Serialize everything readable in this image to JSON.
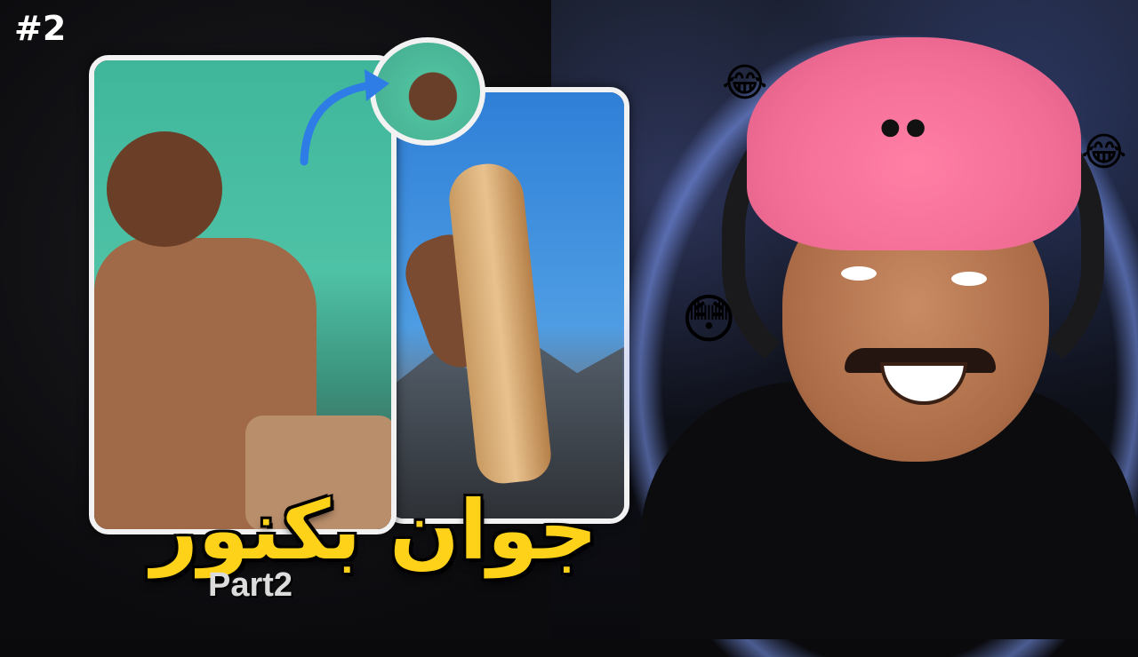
{
  "episode_badge": "#2",
  "title": "جوان بكنور",
  "subtitle": "Part2",
  "emojis": {
    "laughing_top": "😂",
    "laughing_right": "😂",
    "flushed": "😳"
  },
  "colors": {
    "title_yellow": "#ffd21a",
    "beanie_pink": "#f26d96",
    "card_border": "#f2f2f2",
    "arrow_blue": "#2e7de6"
  }
}
